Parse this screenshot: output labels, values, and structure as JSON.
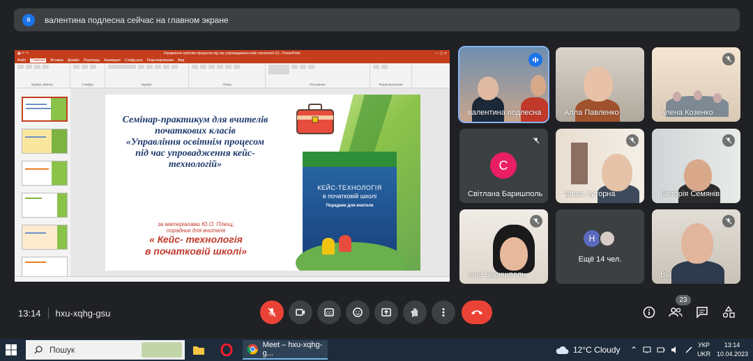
{
  "notification": {
    "avatar_letter": "в",
    "text": "валентина подлесна сейчас на главном экране"
  },
  "presentation": {
    "app_title": "Управління освітнім процесом під час упровадження кейс-технології (1) - PowerPoint",
    "ribbon_tabs": [
      "Файл",
      "Главная",
      "Вставка",
      "Дизайн",
      "Переходы",
      "Анимация",
      "Слайд-шоу",
      "Рецензирование",
      "Вид"
    ],
    "ribbon_groups": [
      "Буфер обмена",
      "Слайды",
      "Шрифт",
      "Абзац",
      "Рисование",
      "Редактирование"
    ],
    "slide": {
      "title_lines": [
        "Семінар-практикум для вчителів",
        "початкових класів",
        "«Управління освітнім процесом",
        "під час упровадження кейс-",
        "технологій»"
      ],
      "source_line1": "за матеріалами  Ю.О. Плющ,",
      "source_line2": "порадник для вчителя",
      "book_ref_line1": "« Кейс- технологія",
      "book_ref_line2": "в початковій школі»",
      "book": {
        "title1": "КЕЙС-ТЕХНОЛОГІЯ",
        "title2": "в початковій школі",
        "subtitle": "Порадник для вчителя"
      }
    },
    "thumb_numbers": [
      "1",
      "2",
      "3",
      "4",
      "5",
      "6"
    ],
    "colors": {
      "ppt_accent": "#c43e1c",
      "slide_green": "#8bc34a",
      "title_blue": "#1f3a6e",
      "ref_red": "#c0392b"
    }
  },
  "participants": [
    {
      "name": "валентина подлесна",
      "speaking": true
    },
    {
      "name": "Алла Павленко",
      "muted": false
    },
    {
      "name": "Алена Козенко",
      "muted": true
    },
    {
      "name": "Світлана Баришполь",
      "avatar_letter": "С",
      "muted": true
    },
    {
      "name": "Даша Хуторна",
      "muted": true
    },
    {
      "name": "Вікторія Семянів",
      "muted": true
    },
    {
      "name": "Інна Баришполь",
      "muted": true
    },
    {
      "name": "Вы",
      "muted": true
    }
  ],
  "more_tile": {
    "avatar_letter": "Н",
    "text": "Ещё 14 чел."
  },
  "meeting": {
    "time": "13:14",
    "code": "hxu-xqhg-gsu",
    "participant_count": "23"
  },
  "controls": {
    "icons": [
      "mic-off-icon",
      "camera-icon",
      "captions-icon",
      "emoji-icon",
      "present-icon",
      "raise-hand-icon",
      "more-icon",
      "hang-up-icon"
    ]
  },
  "taskbar": {
    "search_placeholder": "Пошук",
    "active_app_label": "Meet – hxu-xqhg-g...",
    "weather": "12°C  Cloudy",
    "lang_top": "УКР",
    "lang_bottom": "UKR",
    "clock_time": "13:14",
    "clock_date": "10.04.2023"
  }
}
